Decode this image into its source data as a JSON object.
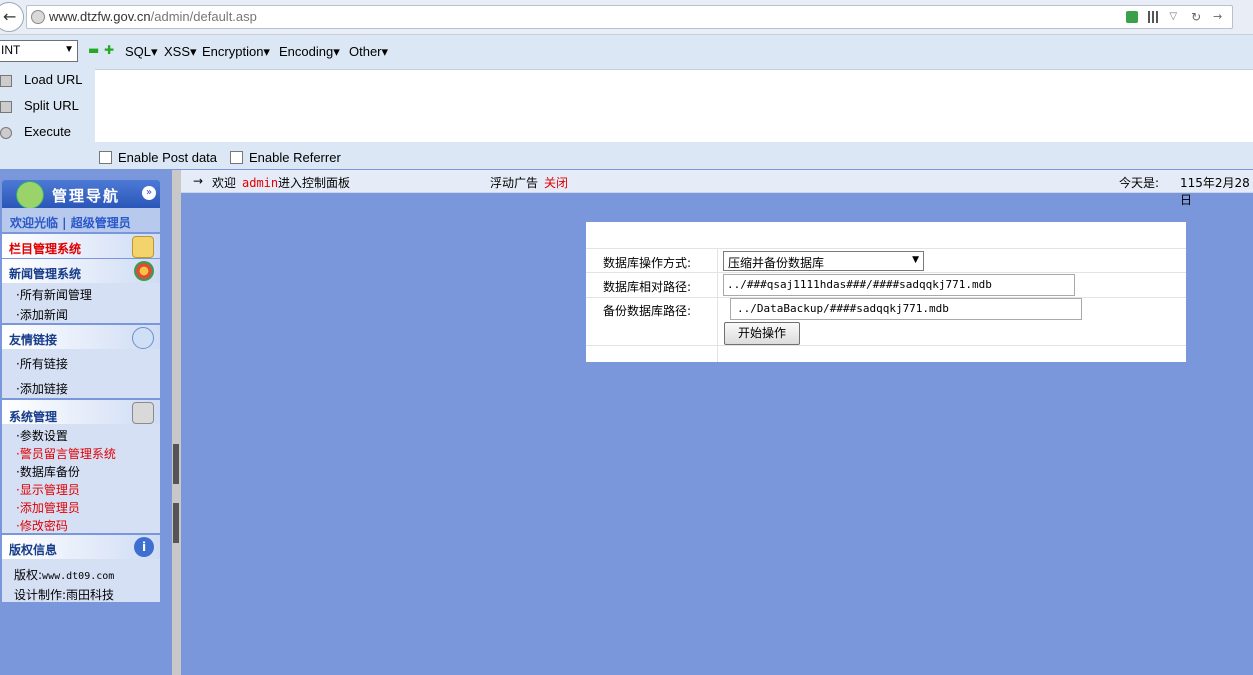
{
  "browser": {
    "url_host": "www.dtzfw.gov.cn",
    "url_path": "/admin/default.asp"
  },
  "hackbar": {
    "type_select": "INT",
    "menus": [
      "SQL▾",
      "XSS▾",
      "Encryption▾",
      "Encoding▾",
      "Other▾"
    ],
    "actions": [
      "Load URL",
      "Split URL",
      "Execute"
    ],
    "checks": [
      "Enable Post data",
      "Enable Referrer"
    ]
  },
  "topbar": {
    "arrow": "→",
    "welcome": "欢迎",
    "user": "admin",
    "enter": "进入控制面板",
    "ad_label": "浮动广告",
    "ad_close": "关闭",
    "today_label": "今天是:",
    "date": "115年2月28日"
  },
  "nav": {
    "title": "管理导航",
    "welcome_line": "欢迎光临 | 超级管理员",
    "column_mgmt": "栏目管理系统",
    "news": {
      "title": "新闻管理系统",
      "items": [
        "·所有新闻管理",
        "·添加新闻"
      ]
    },
    "links": {
      "title": "友情链接",
      "items": [
        "·所有链接",
        "·添加链接"
      ]
    },
    "system": {
      "title": "系统管理",
      "items": [
        "·参数设置",
        "·警员留言管理系统",
        "·数据库备份",
        "·显示管理员",
        "·添加管理员",
        "·修改密码"
      ]
    },
    "copyright": {
      "title": "版权信息",
      "line1_label": "版权:",
      "line1_value": "www.dt09.com",
      "line2": "设计制作:雨田科技"
    }
  },
  "form": {
    "mode_label": "数据库操作方式:",
    "mode_value": "压缩并备份数据库",
    "rel_label": "数据库相对路径:",
    "rel_value": "../###qsaj1111hdas###/####sadqqkj771.mdb",
    "bak_label": "备份数据库路径:",
    "bak_value": "../DataBackup/####sadqqkj771.mdb",
    "submit": "开始操作"
  }
}
